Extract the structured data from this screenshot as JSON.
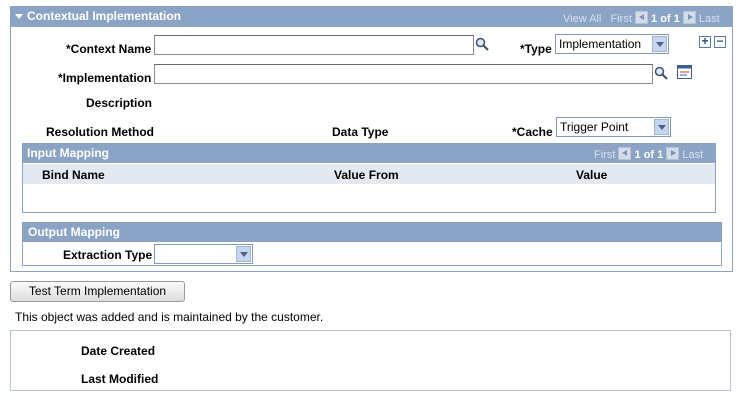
{
  "section": {
    "title": "Contextual Implementation",
    "nav": {
      "view_all": "View All",
      "first": "First",
      "count": "1 of 1",
      "last": "Last"
    }
  },
  "form": {
    "context_name_label": "*Context Name",
    "context_name_value": "",
    "type_label": "*Type",
    "type_value": "Implementation",
    "implementation_label": "*Implementation",
    "implementation_value": "",
    "description_label": "Description",
    "resolution_method_label": "Resolution Method",
    "data_type_label": "Data Type",
    "cache_label": "*Cache",
    "cache_value": "Trigger Point"
  },
  "input_mapping": {
    "title": "Input Mapping",
    "nav": {
      "first": "First",
      "count": "1 of 1",
      "last": "Last"
    },
    "columns": [
      "Bind Name",
      "Value From",
      "Value"
    ]
  },
  "output_mapping": {
    "title": "Output Mapping",
    "extraction_type_label": "Extraction Type",
    "extraction_type_value": ""
  },
  "test_button_label": "Test Term Implementation",
  "info_text": "This object was added and is maintained by the customer.",
  "audit": {
    "date_created_label": "Date Created",
    "last_modified_label": "Last Modified"
  }
}
